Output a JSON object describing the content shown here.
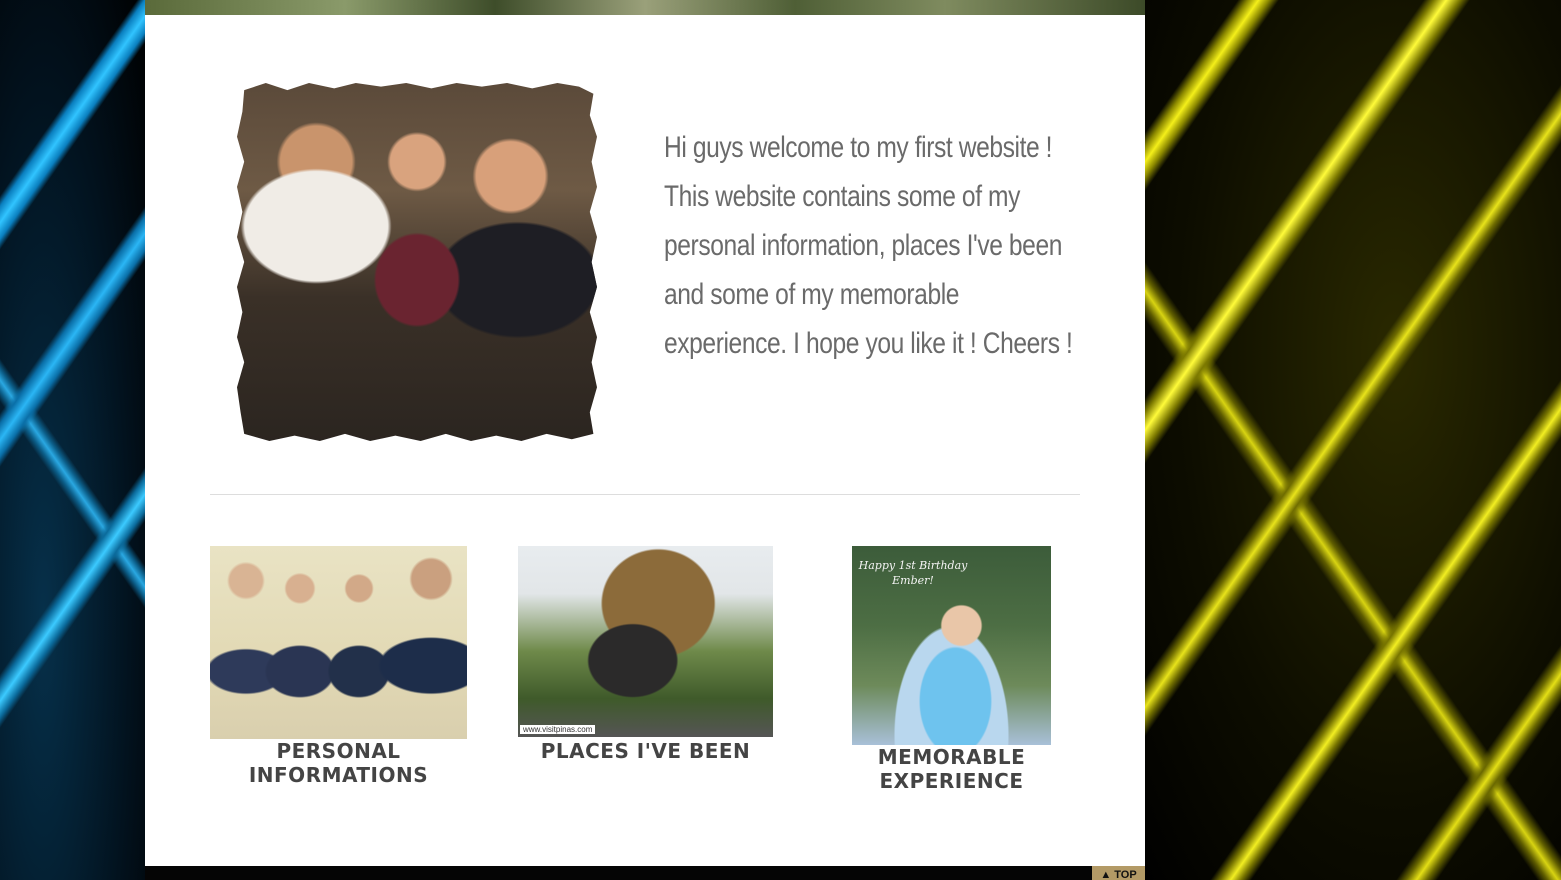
{
  "welcome": {
    "text": "Hi guys welcome to my first website ! This website contains some of my personal information, places I've been and some of my memorable experience. I hope you like it ! Cheers !"
  },
  "cards": [
    {
      "label_line1": "PERSONAL",
      "label_line2": "INFORMATIONS"
    },
    {
      "label_line1": "PLACES I'VE BEEN",
      "label_line2": "",
      "watermark": "www.visitpinas.com"
    },
    {
      "label_line1": "MEMORABLE",
      "label_line2": "EXPERIENCE",
      "photo_caption_line1": "Happy 1st Birthday",
      "photo_caption_line2": "Ember!"
    }
  ],
  "footer": {
    "top_link": "▲ TOP"
  },
  "colors": {
    "left_neon": "#31c4ff",
    "right_neon": "#f4ef1a",
    "text_gray": "#6a6a6a",
    "top_button": "#b39a66"
  }
}
